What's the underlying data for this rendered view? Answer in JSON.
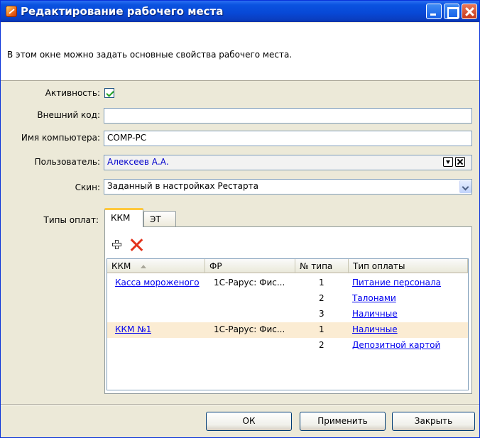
{
  "window": {
    "title": "Редактирование рабочего места"
  },
  "description": "В этом окне можно задать основные свойства рабочего места.",
  "form": {
    "active_label": "Активность:",
    "active_checked": true,
    "external_code_label": "Внешний код:",
    "external_code_value": "",
    "computer_name_label": "Имя компьютера:",
    "computer_name_value": "COMP-PC",
    "user_label": "Пользователь:",
    "user_value": "Алексеев А.А.",
    "skin_label": "Скин:",
    "skin_value": "Заданный в настройках Рестарта",
    "payment_types_label": "Типы оплат:"
  },
  "tabs": [
    {
      "label": "ККМ",
      "active": true
    },
    {
      "label": "ЭТ",
      "active": false
    }
  ],
  "grid": {
    "columns": [
      "ККМ",
      "ФР",
      "№ типа",
      "Тип оплаты"
    ],
    "rows": [
      {
        "kkm": "Касса мороженого",
        "fr": "1С-Рарус: Фис...",
        "type_no": "1",
        "payment": "Питание персонала",
        "selected": false
      },
      {
        "kkm": "",
        "fr": "",
        "type_no": "2",
        "payment": "Талонами",
        "selected": false
      },
      {
        "kkm": "",
        "fr": "",
        "type_no": "3",
        "payment": "Наличные",
        "selected": false
      },
      {
        "kkm": "ККМ №1",
        "fr": "1С-Рарус: Фис...",
        "type_no": "1",
        "payment": "Наличные",
        "selected": true
      },
      {
        "kkm": "",
        "fr": "",
        "type_no": "2",
        "payment": "Депозитной картой",
        "selected": false
      }
    ]
  },
  "buttons": {
    "ok": "ОК",
    "apply": "Применить",
    "close": "Закрыть"
  },
  "colors": {
    "titlebar": "#0848d6",
    "selected_row": "#fbecd3",
    "active_tab_accent": "#ffc83c",
    "delete_icon": "#e3331c"
  }
}
